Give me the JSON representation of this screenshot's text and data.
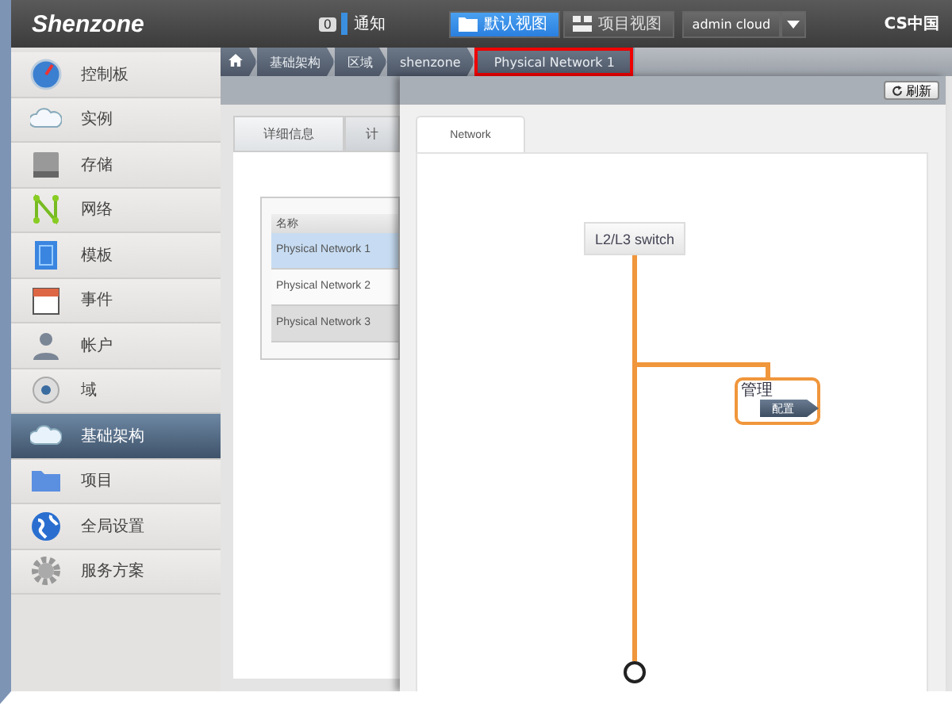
{
  "header": {
    "logo": "Shenzone",
    "notification": {
      "count": "0",
      "label": "通知"
    },
    "views": [
      {
        "label": "默认视图",
        "selected": true,
        "kind": "folder"
      },
      {
        "label": "项目视图",
        "selected": false,
        "kind": "grid"
      }
    ],
    "user": "admin cloud",
    "brand": "CS中国"
  },
  "sidebar": {
    "items": [
      {
        "label": "控制板",
        "selected": false,
        "kind": "dashboard"
      },
      {
        "label": "实例",
        "selected": false,
        "kind": "cloud"
      },
      {
        "label": "存储",
        "selected": false,
        "kind": "storage"
      },
      {
        "label": "网络",
        "selected": false,
        "kind": "network"
      },
      {
        "label": "模板",
        "selected": false,
        "kind": "template"
      },
      {
        "label": "事件",
        "selected": false,
        "kind": "calendar"
      },
      {
        "label": "帐户",
        "selected": false,
        "kind": "user"
      },
      {
        "label": "域",
        "selected": false,
        "kind": "disc"
      },
      {
        "label": "基础架构",
        "selected": true,
        "kind": "cloud"
      },
      {
        "label": "项目",
        "selected": false,
        "kind": "folder"
      },
      {
        "label": "全局设置",
        "selected": false,
        "kind": "globe"
      },
      {
        "label": "服务方案",
        "selected": false,
        "kind": "gear"
      }
    ]
  },
  "breadcrumb": [
    {
      "label": "基础架构",
      "highlighted": false
    },
    {
      "label": "区域",
      "highlighted": false
    },
    {
      "label": "shenzone",
      "highlighted": false
    },
    {
      "label": "Physical Network 1",
      "highlighted": true
    }
  ],
  "detail_panel": {
    "tabs": [
      {
        "label": "详细信息",
        "selected": true
      },
      {
        "label": "计",
        "selected": false
      }
    ],
    "table": {
      "columns": [
        "名称"
      ],
      "rows": [
        {
          "name": "Physical Network 1",
          "selected": true
        },
        {
          "name": "Physical Network 2",
          "selected": false
        },
        {
          "name": "Physical Network 3",
          "selected": false
        }
      ]
    }
  },
  "network_panel": {
    "refresh": "刷新",
    "tabs": [
      {
        "label": "Network",
        "selected": true
      }
    ],
    "diagram": {
      "switch": "L2/L3 switch",
      "traffic": [
        {
          "label": "管理",
          "button": "配置"
        }
      ]
    }
  }
}
